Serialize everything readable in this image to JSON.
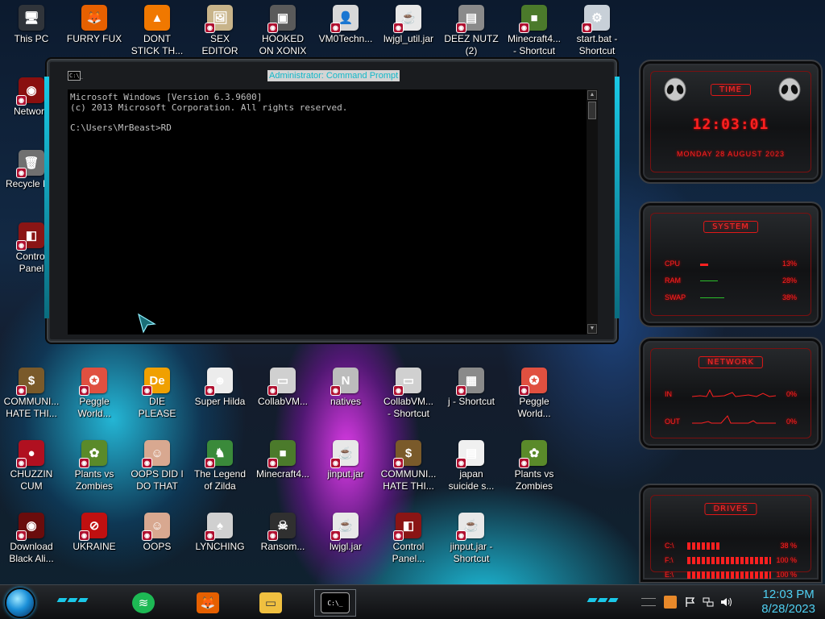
{
  "desktop_icons": [
    {
      "label": "This PC",
      "glyph": "🖥",
      "color": "#30343a"
    },
    {
      "label": "FURRY FUX",
      "glyph": "🦊",
      "color": "#e66000"
    },
    {
      "label": "DONT\nSTICK TH...",
      "glyph": "▲",
      "color": "#f07800"
    },
    {
      "label": "SEX\nEDITOR",
      "glyph": "🖼",
      "color": "#c8b48a"
    },
    {
      "label": "HOOKED\nON XONIX",
      "glyph": "▣",
      "color": "#5a5a5a"
    },
    {
      "label": "VM0Techn...",
      "glyph": "👤",
      "color": "#d8d8d8"
    },
    {
      "label": "lwjgl_util.jar",
      "glyph": "☕",
      "color": "#e8e8e8"
    },
    {
      "label": "DEEZ NUTZ\n(2)",
      "glyph": "▤",
      "color": "#8a8a8a"
    },
    {
      "label": "Minecraft4...\n- Shortcut",
      "glyph": "■",
      "color": "#4b7a2b"
    },
    {
      "label": "start.bat -\nShortcut",
      "glyph": "⚙",
      "color": "#c8d0d8"
    },
    {
      "label": "Network",
      "glyph": "◉",
      "color": "#8a0f0f"
    },
    {
      "label": "Recycle B...",
      "glyph": "🗑",
      "color": "#707070"
    },
    {
      "label": "Control\nPanel",
      "glyph": "◧",
      "color": "#8a1515"
    },
    {
      "label": "COMMUNI...\nHATE THI...",
      "glyph": "$",
      "color": "#7a5a2a"
    },
    {
      "label": "Peggle\nWorld...",
      "glyph": "✪",
      "color": "#e05040"
    },
    {
      "label": "DIE\nPLEASE",
      "glyph": "De",
      "color": "#f0a000"
    },
    {
      "label": "Super Hilda",
      "glyph": "☻",
      "color": "#ececec"
    },
    {
      "label": "CollabVM...",
      "glyph": "▭",
      "color": "#d0d0d0"
    },
    {
      "label": "natives",
      "glyph": "N",
      "color": "#bcbcbc"
    },
    {
      "label": "CollabVM...\n- Shortcut",
      "glyph": "▭",
      "color": "#d0d0d0"
    },
    {
      "label": "j - Shortcut",
      "glyph": "▦",
      "color": "#8a8a8a"
    },
    {
      "label": "Peggle\nWorld...",
      "glyph": "✪",
      "color": "#e05040"
    },
    {
      "label": "CHUZZIN\nCUM",
      "glyph": "●",
      "color": "#b01020"
    },
    {
      "label": "Plants vs\nZombies",
      "glyph": "✿",
      "color": "#5a8a2a"
    },
    {
      "label": "OOPS DID I\nDO THAT",
      "glyph": "☺",
      "color": "#d8a890"
    },
    {
      "label": "The Legend\nof Zilda",
      "glyph": "♞",
      "color": "#3a8a3a"
    },
    {
      "label": "Minecraft4...",
      "glyph": "■",
      "color": "#4b7a2b"
    },
    {
      "label": "jinput.jar",
      "glyph": "☕",
      "color": "#e8e8e8"
    },
    {
      "label": "COMMUNI...\nHATE THI...",
      "glyph": "$",
      "color": "#7a5a2a"
    },
    {
      "label": "japan\nsuicide s...",
      "glyph": "▤",
      "color": "#f0f0f0"
    },
    {
      "label": "Plants vs\nZombies",
      "glyph": "✿",
      "color": "#5a8a2a"
    },
    {
      "label": "Download\nBlack Ali...",
      "glyph": "◉",
      "color": "#6a0c0c"
    },
    {
      "label": "UKRAINE",
      "glyph": "⊘",
      "color": "#c01010"
    },
    {
      "label": "OOPS",
      "glyph": "☺",
      "color": "#d8a890"
    },
    {
      "label": "LYNCHING",
      "glyph": "♠",
      "color": "#d0d0d0"
    },
    {
      "label": "Ransom...",
      "glyph": "☠",
      "color": "#303030"
    },
    {
      "label": "lwjgl.jar",
      "glyph": "☕",
      "color": "#e8e8e8"
    },
    {
      "label": "Control\nPanel...",
      "glyph": "◧",
      "color": "#8a1515"
    },
    {
      "label": "jinput.jar -\nShortcut",
      "glyph": "☕",
      "color": "#e8e8e8"
    }
  ],
  "cmd_window": {
    "title": "Administrator: Command Prompt",
    "icon_text": "C:\\_",
    "console_text": "Microsoft Windows [Version 6.3.9600]\n(c) 2013 Microsoft Corporation. All rights reserved.\n\nC:\\Users\\MrBeast>RD",
    "scroll_up": "▲",
    "scroll_down": "▼"
  },
  "widgets": {
    "time": {
      "header": "TIME",
      "clock": "12:03:01",
      "date": "MONDAY 28 AUGUST 2023"
    },
    "system": {
      "header": "SYSTEM",
      "rows": [
        {
          "label": "CPU",
          "value": "13%",
          "fraction": 0.13
        },
        {
          "label": "RAM",
          "value": "28%",
          "fraction": 0.28
        },
        {
          "label": "SWAP",
          "value": "38%",
          "fraction": 0.38
        }
      ]
    },
    "network": {
      "header": "NETWORK",
      "rows": [
        {
          "label": "IN",
          "value": "0%"
        },
        {
          "label": "OUT",
          "value": "0%"
        }
      ]
    },
    "drives": {
      "header": "DRIVES",
      "rows": [
        {
          "label": "C:\\",
          "value": "38 %",
          "fraction": 0.38
        },
        {
          "label": "F:\\",
          "value": "100 %",
          "fraction": 1.0
        },
        {
          "label": "E:\\",
          "value": "100 %",
          "fraction": 1.0
        }
      ]
    }
  },
  "taskbar": {
    "apps": [
      {
        "name": "spotify-icon",
        "glyph": "≋",
        "color": "#1db954"
      },
      {
        "name": "firefox-icon",
        "glyph": "🦊",
        "color": "#e66000"
      },
      {
        "name": "file-explorer-icon",
        "glyph": "▭",
        "color": "#f0c040"
      },
      {
        "name": "command-prompt-icon",
        "glyph": "C:\\_",
        "color": "#000000"
      }
    ],
    "tray_icons": [
      "flag-icon",
      "network-icon",
      "volume-icon"
    ],
    "time": "12:03 PM",
    "date": "8/28/2023"
  },
  "colors": {
    "accent_cyan": "#1ac8e8",
    "widget_red": "#ff2020"
  }
}
